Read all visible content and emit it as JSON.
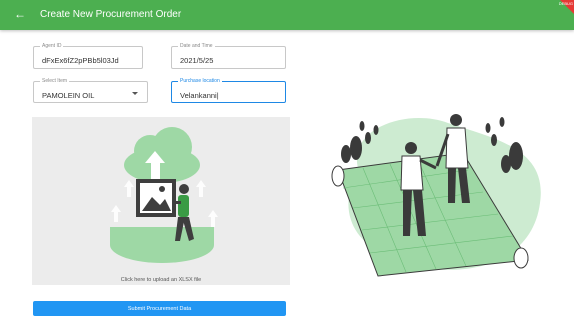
{
  "appbar": {
    "title": "Create New Procurement Order",
    "back_icon": "arrow-back-icon",
    "color": "#4caf50"
  },
  "fields": {
    "agent_id": {
      "label": "Agent ID",
      "value": "dFxEx6fZ2pPBb5l03Jd"
    },
    "date": {
      "label": "Date and Time",
      "value": "2021/5/25"
    },
    "select_item": {
      "label": "Select Item",
      "value": "PAMOLEIN OIL"
    },
    "purchase_location": {
      "label": "Purchase location",
      "value": "Velankanni|"
    }
  },
  "upload": {
    "text": "Click here to upload an XLSX file"
  },
  "submit": {
    "label": "Submit Procurement Data",
    "color": "#2196f3"
  }
}
